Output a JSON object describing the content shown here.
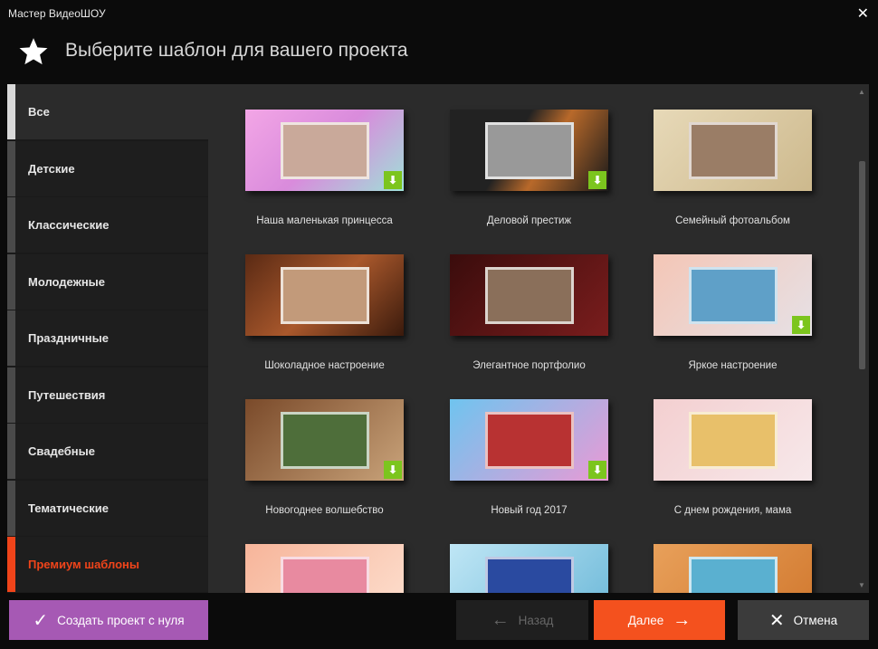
{
  "window": {
    "title": "Мастер ВидеоШОУ",
    "close_icon": "close-icon"
  },
  "header": {
    "title": "Выберите шаблон для вашего проекта",
    "icon": "star-icon"
  },
  "sidebar": {
    "items": [
      {
        "label": "Все",
        "active": true
      },
      {
        "label": "Детские"
      },
      {
        "label": "Классические"
      },
      {
        "label": "Молодежные"
      },
      {
        "label": "Праздничные"
      },
      {
        "label": "Путешествия"
      },
      {
        "label": "Свадебные"
      },
      {
        "label": "Тематические"
      },
      {
        "label": "Премиум шаблоны",
        "premium": true
      }
    ]
  },
  "templates": [
    {
      "name": "Наша маленькая принцесса",
      "download": true
    },
    {
      "name": "Деловой престиж",
      "download": true
    },
    {
      "name": "Семейный фотоальбом",
      "download": false
    },
    {
      "name": "Шоколадное настроение",
      "download": false
    },
    {
      "name": "Элегантное портфолио",
      "download": false
    },
    {
      "name": "Яркое настроение",
      "download": true
    },
    {
      "name": "Новогоднее волшебство",
      "download": true
    },
    {
      "name": "Новый год 2017",
      "download": true
    },
    {
      "name": "С днем рождения, мама",
      "download": false
    },
    {
      "name": "",
      "download": false
    },
    {
      "name": "",
      "download": false
    },
    {
      "name": "",
      "download": false
    }
  ],
  "buttons": {
    "create": "Создать проект с нуля",
    "back": "Назад",
    "next": "Далее",
    "cancel": "Отмена"
  },
  "colors": {
    "accent": "#f4511e",
    "create": "#a659b4",
    "download": "#7cc51e"
  }
}
